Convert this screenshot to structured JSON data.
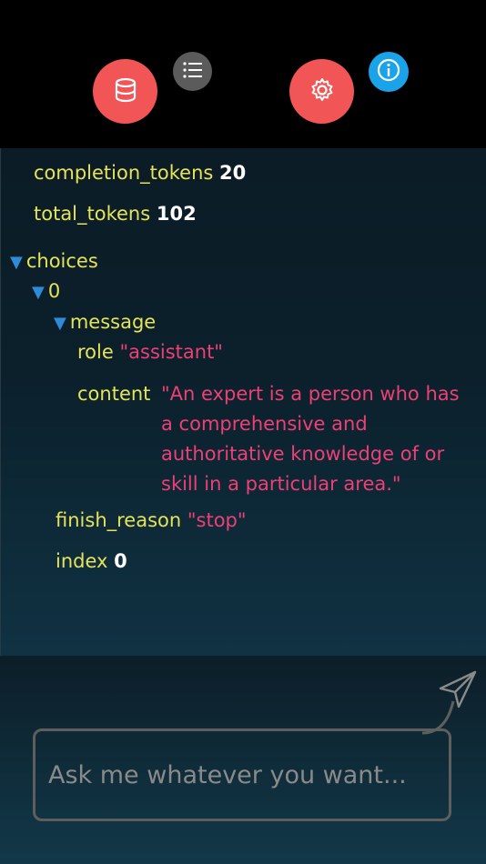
{
  "toolbar": {
    "buttons": [
      {
        "icon": "database-icon",
        "color": "#f25555"
      },
      {
        "icon": "list-icon",
        "color": "#5b5b5b"
      },
      {
        "icon": "gear-icon",
        "color": "#f25555"
      },
      {
        "icon": "info-icon",
        "color": "#1aa3e8"
      }
    ]
  },
  "json_view": {
    "completion_tokens_key": "completion_tokens",
    "completion_tokens_value": "20",
    "total_tokens_key": "total_tokens",
    "total_tokens_value": "102",
    "choices_key": "choices",
    "index0_key": "0",
    "message_key": "message",
    "role_key": "role",
    "role_value": "\"assistant\"",
    "content_key": "content",
    "content_value": "\"An expert is a person who has a comprehensive and authoritative knowledge of or skill in a particular area.\"",
    "finish_reason_key": "finish_reason",
    "finish_reason_value": "\"stop\"",
    "index_key": "index",
    "index_value": "0"
  },
  "composer": {
    "placeholder": "Ask me whatever you want...",
    "send_icon": "send-icon"
  }
}
